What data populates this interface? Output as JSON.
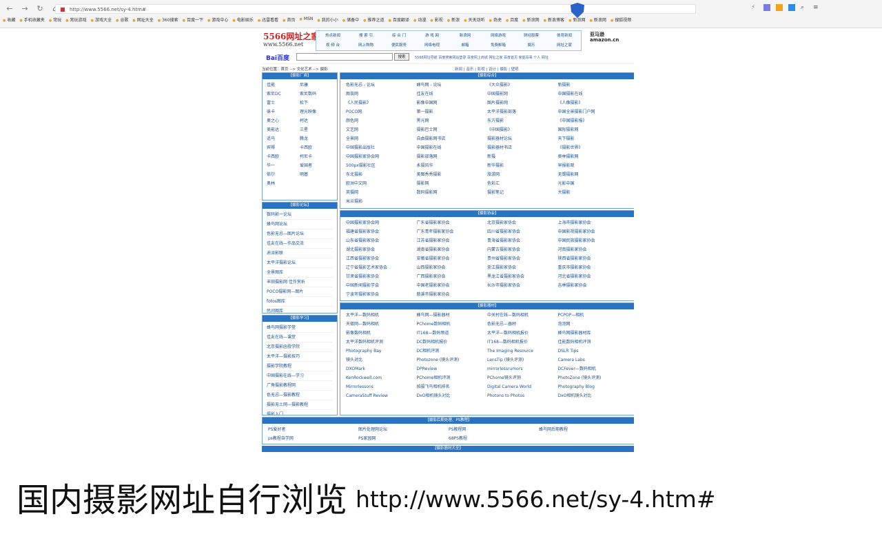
{
  "browser": {
    "url": "http://www.5566.net/sy-4.htm#",
    "bookmarks": [
      "收藏",
      "手机收藏夹",
      "常玩",
      "常玩游戏",
      "游戏大全",
      "谷歌",
      "网址大全",
      "360搜索",
      "百度一下",
      "游戏中心",
      "电影娱乐",
      "迅雷看看",
      "首页",
      "MSN",
      "我的小小",
      "储备中",
      "推荐之道",
      "百度翻译",
      "动漫",
      "影视",
      "新浪",
      "天天动听",
      "奇虎",
      "百度",
      "新浪网",
      "新浪博客",
      "新浪网",
      "新浪网",
      "搜狐视频"
    ]
  },
  "site": {
    "logo": "5566网址之家",
    "logo_url": "www.5566.net",
    "top_links": [
      "热点新闻",
      "搜 索 引",
      "综 合 门",
      "游 戏 网",
      "新浪网",
      "网络游戏",
      "财经股票",
      "体育新闻",
      "视 频 台",
      "网上购物",
      "便民服务",
      "网络电视",
      "邮箱",
      "免费邮箱",
      "娱乐",
      "网址之家"
    ],
    "amazon": "亚马逊 amazon.cn"
  },
  "search": {
    "logo": "Bai百度",
    "button": "搜索",
    "links": "5566网址导航  百度搜索网站登录  百度网上商城  网址之家  百度首页  家庭百事  个人  网址"
  },
  "breadcrumb": {
    "left": "当前位置：首页 --> 文化艺术 --> 摄影",
    "right": "新闻 | 音乐 | 影视 | 设计 | 摄影 | 壁纸"
  },
  "left_boxes": [
    {
      "title": "【摄影厂商】",
      "items": [
        "佳能",
        "尼康",
        "索尼DC",
        "索尼数码",
        "富士",
        "松下",
        "徕卡",
        "理光映像",
        "奥之心",
        "柯达",
        "美能达",
        "三星",
        "适马",
        "腾龙",
        "宾得",
        "卡西欧",
        "卡西欧",
        "柯尼卡",
        "华一",
        "爱国者",
        "依尔",
        "明基",
        "奥林"
      ]
    },
    {
      "title": "【摄影论坛】",
      "items": [
        "数码影一论坛",
        "蜂鸟网论坛",
        "色影无忌—图片论坛",
        "佳友在线—作品交流",
        "迪派影联",
        "太平洋摄影论坛",
        "全景图库",
        "丰田摄影网  佳作赏析",
        "POCO摄影网—图片",
        "fotos图库",
        "民间图库"
      ]
    },
    {
      "title": "【摄影学习】",
      "items": [
        "蜂鸟网摄影学堂",
        "佳友在线—课堂",
        "北京摄影函授学院",
        "太平洋—摄影技巧",
        "摄影学院教程",
        "中国摄影在线—学习",
        "广角摄影教程网",
        "色无忌—摄影教程",
        "摄影无土网—摄影教程",
        "摄影入门"
      ]
    }
  ],
  "right_boxes": [
    {
      "title": "【摄影综合】",
      "items": [
        "色影无忌 - 论坛",
        "蜂鸟网 - 论坛",
        "《大众摄影》",
        "新摄影",
        "图虫网",
        "佳友在线",
        "中国摄影网",
        "中国摄影在线",
        "《人民摄影》",
        "影像中国网",
        "图片摄影网",
        "《人像摄影》",
        "POCO网",
        "第一摄影",
        "太平洋摄影部落",
        "中国全景摄影门户网",
        "颜色网",
        "黑光网",
        "东方摄影",
        "《中国摄影报》",
        "文艺网",
        "摄影巴士网",
        "《中国摄影》",
        "国际摄影网",
        "全景网",
        "自由摄影网书店",
        "摄影器材论坛",
        "天下摄影",
        "中国摄影出版社",
        "中国摄影在线",
        "摄影器材书店",
        "《摄影世界》",
        "中国摄影家协会网",
        "摄影部落网",
        "新摄",
        "奥林摄影网",
        "500px摄影社区",
        "永摄风华",
        "新华摄影",
        "早报影观",
        "东北摄影",
        "美图秀秀摄影",
        "旅游网",
        "无锡摄影网",
        "欧洲中文网",
        "摄影网",
        "色彩汇",
        "光影中国",
        "英摄网",
        "数码摄影网",
        "摄影笔记",
        "大摄影",
        "米兰摄影"
      ]
    },
    {
      "title": "【摄影协会】",
      "items": [
        "中国摄影家协会网",
        "广东省摄影家协会",
        "北京摄影家协会",
        "上海市摄影家协会",
        "福建省摄影家协会",
        "广东青年摄影家协会",
        "四川省摄影家协会",
        "中国影视摄影家协会",
        "山东省摄影家协会",
        "江苏省摄影家协会",
        "青海省摄影家协会",
        "中国民族摄影家协会",
        "湖北摄影家协会",
        "湖南省摄影家协会",
        "内蒙古摄影家协会",
        "河南摄影家协会",
        "江西省摄影家协会",
        "安徽省摄影家协会",
        "贵州省摄影家协会",
        "陕西省摄影家协会",
        "辽宁省摄影艺术家协会",
        "山西摄影家协会",
        "浙江摄影家协会",
        "重庆市摄影家协会",
        "甘肃省摄影家协会",
        "广西摄影家协会",
        "黑龙江省摄影家协会",
        "河北省摄影家协会",
        "中国新闻摄影学会",
        "中国老摄影家协会",
        "长沙市摄影家协会",
        "吉林摄影家协会",
        "宁波市摄影家协会",
        "慈溪市摄影家协会"
      ]
    },
    {
      "title": "【摄影器材】",
      "items": [
        "太平洋—数码相机",
        "蜂鸟网—摄影器材",
        "中关村在线—数码相机",
        "PCPOP—相机",
        "天极网—数码相机",
        "PChome数码相机",
        "色影无忌—器材",
        "泡泡网",
        "影像数码相机",
        "IT168—数码频道",
        "太平洋—数码相机报价",
        "蜂鸟网摄影器材库",
        "太平洋数码相机评测",
        "DC数码相机报价",
        "IT168—数码相机报价",
        "佳能数码相机评测",
        "Photography Bay",
        "DC相机评测",
        "The Imaging Resource",
        "DSLR Tips",
        "镜头对比",
        "Photozone (镜头评测)",
        "LensTip (镜头评测)",
        "Camera Labs",
        "DXOMark",
        "DPReview",
        "mirrorlessrumors",
        "DCFever—数码相机",
        "KenRockwell.com",
        "PChome相机评测",
        "PChome镜头评测",
        "PhotoZone (镜头评测)",
        "Mirrorlessons",
        "拍摄飞鸟相机排名",
        "Digital Camera World",
        "Photography Blog",
        "CameraStuff Review",
        "DxO相机镜头对比",
        "Photons to Photos",
        "DxO相机镜头对比"
      ]
    }
  ],
  "bottom_box": {
    "title": "【摄影后期处理、PS教程】",
    "items": [
      "PS爱好者",
      "图片处理网论坛",
      "PS教程网",
      "蜂鸟网后期教程",
      "ps教程自学网",
      "PS家园网",
      "68PS教程"
    ]
  },
  "last_head": "【摄影器材大全】",
  "caption": {
    "text": "国内摄影网址自行浏览",
    "url": "http://www.5566.net/sy-4.htm#"
  }
}
